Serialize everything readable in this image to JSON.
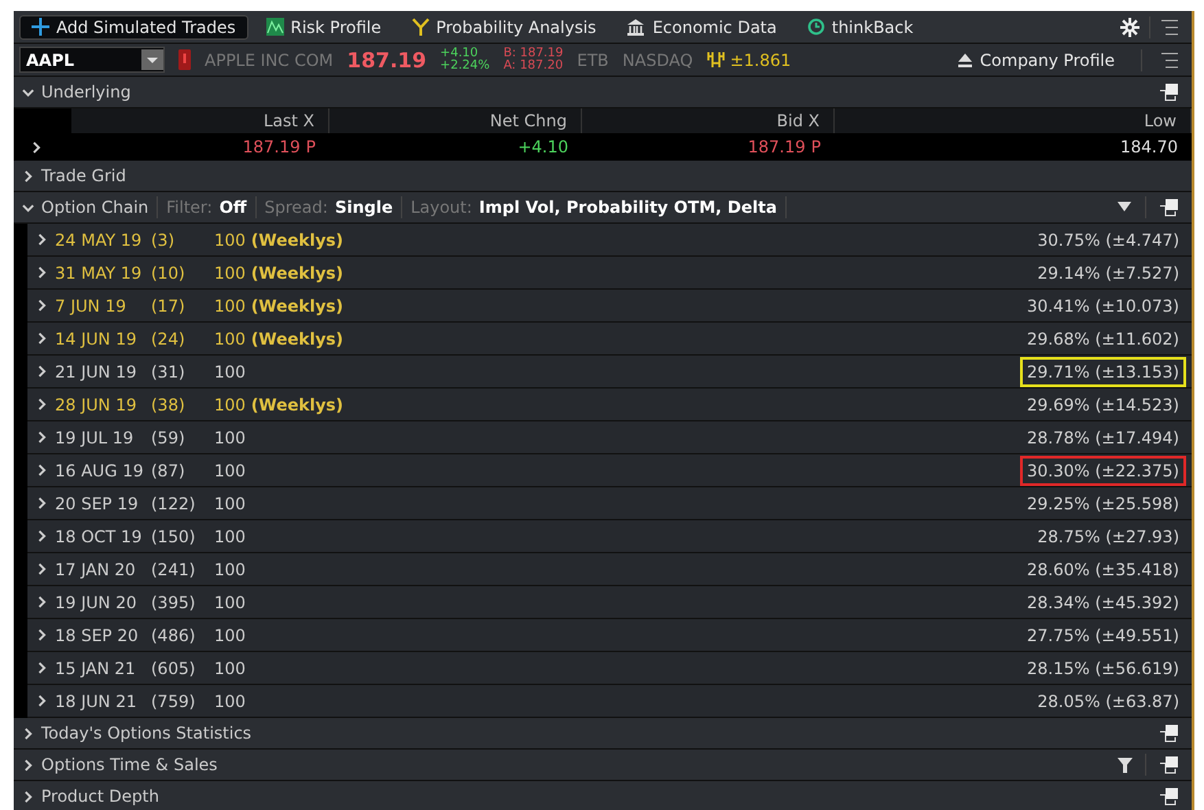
{
  "toolbar": {
    "items": [
      {
        "kind": "add",
        "label": "Add Simulated Trades",
        "selected": true
      },
      {
        "kind": "risk",
        "label": "Risk Profile",
        "selected": false
      },
      {
        "kind": "prob",
        "label": "Probability Analysis",
        "selected": false
      },
      {
        "kind": "econ",
        "label": "Economic Data",
        "selected": false
      },
      {
        "kind": "back",
        "label": "thinkBack",
        "selected": false
      }
    ]
  },
  "symbol_bar": {
    "symbol": "AAPL",
    "company": "APPLE INC COM",
    "last": "187.19",
    "change": "+4.10",
    "change_pct": "+2.24%",
    "bid": "B: 187.19",
    "ask": "A: 187.20",
    "etb": "ETB",
    "exchange": "NASDAQ",
    "expected_move": "±1.861",
    "profile": "Company Profile"
  },
  "underlying": {
    "title": "Underlying",
    "expanded": true,
    "columns": [
      {
        "label": "Last X",
        "value": "187.19",
        "suffix": "P",
        "color": "#e0505a"
      },
      {
        "label": "Net Chng",
        "value": "+4.10",
        "color": "#4cd35c"
      },
      {
        "label": "Bid X",
        "value": "187.19",
        "suffix": "P",
        "color": "#e0505a"
      },
      {
        "label": "Low",
        "value": "184.70"
      }
    ]
  },
  "trade_grid": {
    "title": "Trade Grid",
    "expanded": false
  },
  "option_chain": {
    "title": "Option Chain",
    "expanded": true,
    "filter_label": "Filter:",
    "filter": "Off",
    "spread_label": "Spread:",
    "spread": "Single",
    "layout_label": "Layout:",
    "layout": "Impl Vol, Probability OTM, Delta",
    "rows": [
      {
        "date": "24 MAY 19",
        "days": "(3)",
        "mult": "100",
        "series": "(Weeklys)",
        "weekly": true,
        "value": "30.75% (±4.747)",
        "outlined": false
      },
      {
        "date": "31 MAY 19",
        "days": "(10)",
        "mult": "100",
        "series": "(Weeklys)",
        "weekly": true,
        "value": "29.14% (±7.527)",
        "outlined": false
      },
      {
        "date": "7 JUN 19",
        "days": "(17)",
        "mult": "100",
        "series": "(Weeklys)",
        "weekly": true,
        "value": "30.41% (±10.073)",
        "outlined": false
      },
      {
        "date": "14 JUN 19",
        "days": "(24)",
        "mult": "100",
        "series": "(Weeklys)",
        "weekly": true,
        "value": "29.68% (±11.602)",
        "outlined": false
      },
      {
        "date": "21 JUN 19",
        "days": "(31)",
        "mult": "100",
        "weekly": false,
        "value": "29.71% (±13.153)",
        "outlined": true,
        "color": "#e6e01c"
      },
      {
        "date": "28 JUN 19",
        "days": "(38)",
        "mult": "100",
        "series": "(Weeklys)",
        "weekly": true,
        "value": "29.69% (±14.523)",
        "outlined": false
      },
      {
        "date": "19 JUL 19",
        "days": "(59)",
        "mult": "100",
        "weekly": false,
        "value": "28.78% (±17.494)",
        "outlined": false
      },
      {
        "date": "16 AUG 19",
        "days": "(87)",
        "mult": "100",
        "weekly": false,
        "value": "30.30% (±22.375)",
        "outlined": true,
        "color": "#e02828"
      },
      {
        "date": "20 SEP 19",
        "days": "(122)",
        "mult": "100",
        "weekly": false,
        "value": "29.25% (±25.598)",
        "outlined": false
      },
      {
        "date": "18 OCT 19",
        "days": "(150)",
        "mult": "100",
        "weekly": false,
        "value": "28.75% (±27.93)",
        "outlined": false
      },
      {
        "date": "17 JAN 20",
        "days": "(241)",
        "mult": "100",
        "weekly": false,
        "value": "28.60% (±35.418)",
        "outlined": false
      },
      {
        "date": "19 JUN 20",
        "days": "(395)",
        "mult": "100",
        "weekly": false,
        "value": "28.34% (±45.392)",
        "outlined": false
      },
      {
        "date": "18 SEP 20",
        "days": "(486)",
        "mult": "100",
        "weekly": false,
        "value": "27.75% (±49.551)",
        "outlined": false
      },
      {
        "date": "15 JAN 21",
        "days": "(605)",
        "mult": "100",
        "weekly": false,
        "value": "28.15% (±56.619)",
        "outlined": false
      },
      {
        "date": "18 JUN 21",
        "days": "(759)",
        "mult": "100",
        "weekly": false,
        "value": "28.05% (±63.87)",
        "outlined": false
      }
    ]
  },
  "sections": [
    {
      "title": "Today's Options Statistics",
      "expanded": false,
      "filter": false
    },
    {
      "title": "Options Time & Sales",
      "expanded": false,
      "filter": true
    },
    {
      "title": "Product Depth",
      "expanded": false,
      "filter": false
    }
  ]
}
